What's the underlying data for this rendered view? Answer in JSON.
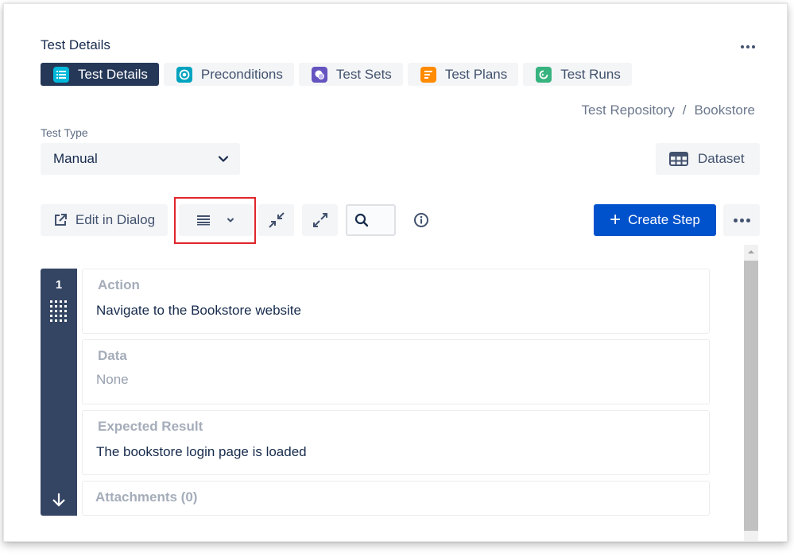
{
  "header": {
    "title": "Test Details"
  },
  "tabs": [
    {
      "label": "Test Details",
      "icon": "list-icon",
      "color": "#00b8d9",
      "active": true
    },
    {
      "label": "Preconditions",
      "icon": "precondition-icon",
      "color": "#00a3bf",
      "active": false
    },
    {
      "label": "Test Sets",
      "icon": "test-set-icon",
      "color": "#6554c0",
      "active": false
    },
    {
      "label": "Test Plans",
      "icon": "test-plan-icon",
      "color": "#ff8b00",
      "active": false
    },
    {
      "label": "Test Runs",
      "icon": "test-run-icon",
      "color": "#36b37e",
      "active": false
    }
  ],
  "breadcrumb": {
    "items": [
      "Test Repository",
      "Bookstore"
    ],
    "separator": "/"
  },
  "test_type": {
    "label": "Test Type",
    "value": "Manual"
  },
  "dataset": {
    "label": "Dataset"
  },
  "toolbar": {
    "edit_dialog": "Edit in Dialog",
    "create_step": "Create Step"
  },
  "step": {
    "number": "1",
    "action": {
      "label": "Action",
      "value": "Navigate to the Bookstore website"
    },
    "data": {
      "label": "Data",
      "value": "None"
    },
    "expected": {
      "label": "Expected Result",
      "value": "The bookstore login page is loaded"
    },
    "attachments": {
      "label": "Attachments (0)"
    }
  },
  "colors": {
    "primary": "#0052cc",
    "active_tab": "#253858",
    "step_sidebar": "#344563",
    "highlight": "#e0262c"
  }
}
